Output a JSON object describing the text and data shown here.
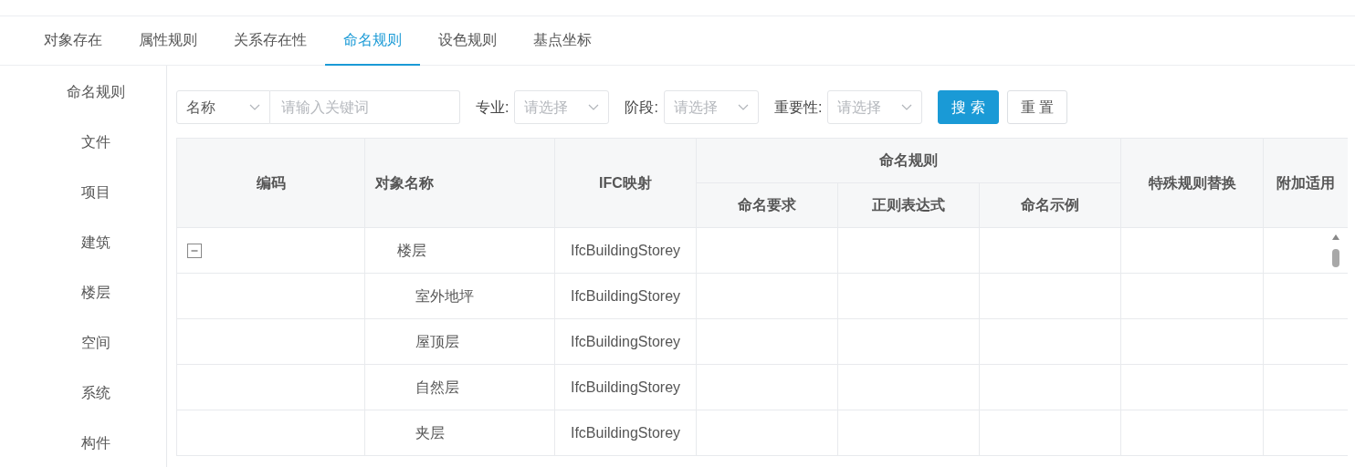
{
  "tabs": [
    {
      "label": "对象存在",
      "selected": false
    },
    {
      "label": "属性规则",
      "selected": false
    },
    {
      "label": "关系存在性",
      "selected": false
    },
    {
      "label": "命名规则",
      "selected": true
    },
    {
      "label": "设色规则",
      "selected": false
    },
    {
      "label": "基点坐标",
      "selected": false
    }
  ],
  "sidebar": {
    "items": [
      "命名规则",
      "文件",
      "项目",
      "建筑",
      "楼层",
      "空间",
      "系统",
      "构件"
    ]
  },
  "filters": {
    "field_select": {
      "value": "名称"
    },
    "keyword": {
      "placeholder": "请输入关键词"
    },
    "selects": [
      {
        "label": "专业:",
        "placeholder": "请选择"
      },
      {
        "label": "阶段:",
        "placeholder": "请选择"
      },
      {
        "label": "重要性:",
        "placeholder": "请选择"
      }
    ],
    "buttons": [
      {
        "label": "搜 索",
        "kind": "primary"
      },
      {
        "label": "重 置",
        "kind": "default"
      }
    ]
  },
  "table": {
    "columns": [
      {
        "label": "编码"
      },
      {
        "label": "对象名称"
      },
      {
        "label": "IFC映射"
      },
      {
        "label": "命名规则",
        "children": [
          {
            "label": "命名要求"
          },
          {
            "label": "正则表达式"
          },
          {
            "label": "命名示例"
          }
        ]
      },
      {
        "label": "特殊规则替换"
      },
      {
        "label": "附加适用"
      }
    ],
    "rows": [
      {
        "name": "楼层",
        "ifc": "IfcBuildingStorey",
        "expanded": true,
        "children": [
          {
            "name": "室外地坪",
            "ifc": "IfcBuildingStorey"
          },
          {
            "name": "屋顶层",
            "ifc": "IfcBuildingStorey"
          },
          {
            "name": "自然层",
            "ifc": "IfcBuildingStorey"
          },
          {
            "name": "夹层",
            "ifc": "IfcBuildingStorey"
          }
        ]
      }
    ]
  }
}
